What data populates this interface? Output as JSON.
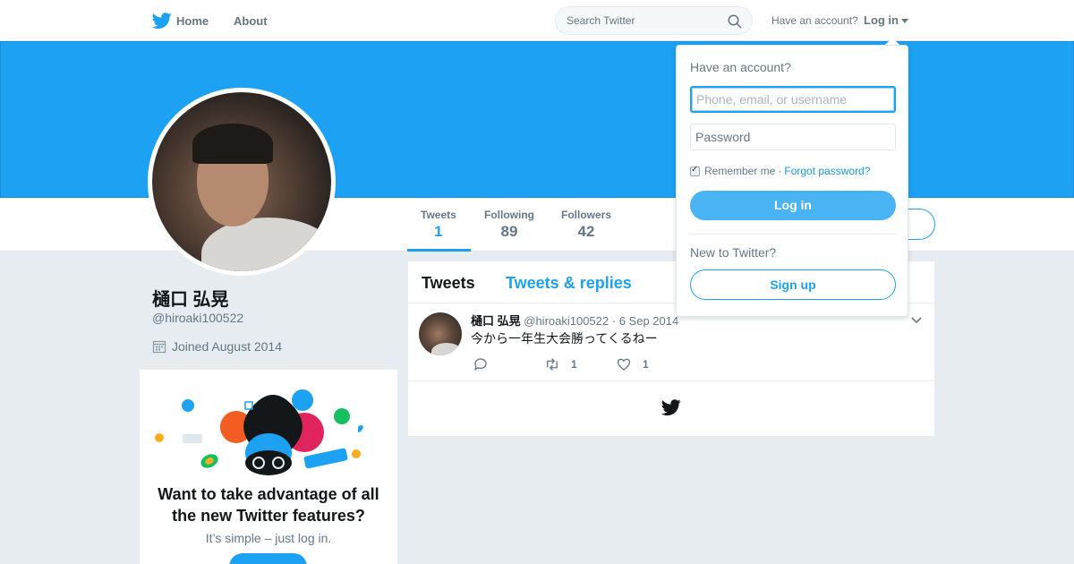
{
  "nav": {
    "home_label": "Home",
    "about_label": "About",
    "search_placeholder": "Search Twitter",
    "have_account": "Have an account?",
    "login_label": "Log in"
  },
  "profile": {
    "name": "樋口 弘晃",
    "handle": "@hiroaki100522",
    "joined": "Joined August 2014",
    "stats": [
      {
        "label": "Tweets",
        "value": "1"
      },
      {
        "label": "Following",
        "value": "89"
      },
      {
        "label": "Followers",
        "value": "42"
      }
    ]
  },
  "promo": {
    "title": "Want to take advantage of all the new Twitter features?",
    "subtitle": "It’s simple – just log in."
  },
  "timeline": {
    "tabs": [
      "Tweets",
      "Tweets & replies"
    ],
    "tweet": {
      "name": "樋口 弘晃",
      "handle": "@hiroaki100522",
      "date": "6 Sep 2014",
      "text": "今から一年生大会勝ってくるねー",
      "retweets": "1",
      "likes": "1"
    }
  },
  "login_dropdown": {
    "title": "Have an account?",
    "username_placeholder": "Phone, email, or username",
    "password_placeholder": "Password",
    "remember_label": "Remember me",
    "forgot_label": "Forgot password?",
    "login_button": "Log in",
    "new_to_twitter": "New to Twitter?",
    "signup_button": "Sign up"
  },
  "colors": {
    "brand_blue": "#1da1f2",
    "page_background": "#e6ecf0",
    "muted_text": "#657786"
  }
}
